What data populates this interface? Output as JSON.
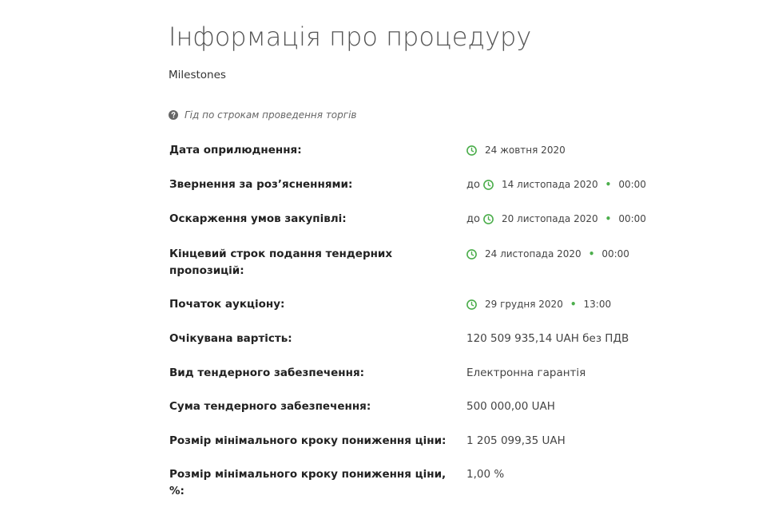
{
  "header": {
    "title": "Інформація про процедуру",
    "subtitle": "Milestones",
    "guide_link": "Гід по строкам проведення торгів"
  },
  "colors": {
    "accent_green": "#4cae4c",
    "title_gray": "#555555",
    "label_dark": "#222222"
  },
  "icons": {
    "question": "question-circle-icon",
    "clock": "clock-icon"
  },
  "rows": [
    {
      "label": "Дата оприлюднення:",
      "prefix": "",
      "date": "24 жовтня 2020",
      "time": ""
    },
    {
      "label": "Звернення за роз’ясненнями:",
      "prefix": "до",
      "date": "14 листопада 2020",
      "time": "00:00"
    },
    {
      "label": "Оскарження умов закупівлі:",
      "prefix": "до",
      "date": "20 листопада 2020",
      "time": "00:00"
    },
    {
      "label": "Кінцевий строк подання тендерних пропозицій:",
      "prefix": "",
      "date": "24 листопада 2020",
      "time": "00:00"
    },
    {
      "label": "Початок аукціону:",
      "prefix": "",
      "date": "29 грудня 2020",
      "time": "13:00"
    },
    {
      "label": "Очікувана вартість:",
      "value": "120 509 935,14 UAH без ПДВ"
    },
    {
      "label": "Вид тендерного забезпечення:",
      "value": "Електронна гарантія"
    },
    {
      "label": "Сума тендерного забезпечення:",
      "value": "500 000,00 UAH"
    },
    {
      "label": "Розмір мінімального кроку пониження ціни:",
      "value": "1 205 099,35 UAH"
    },
    {
      "label": "Розмір мінімального кроку пониження ціни, %:",
      "value": "1,00 %"
    }
  ]
}
